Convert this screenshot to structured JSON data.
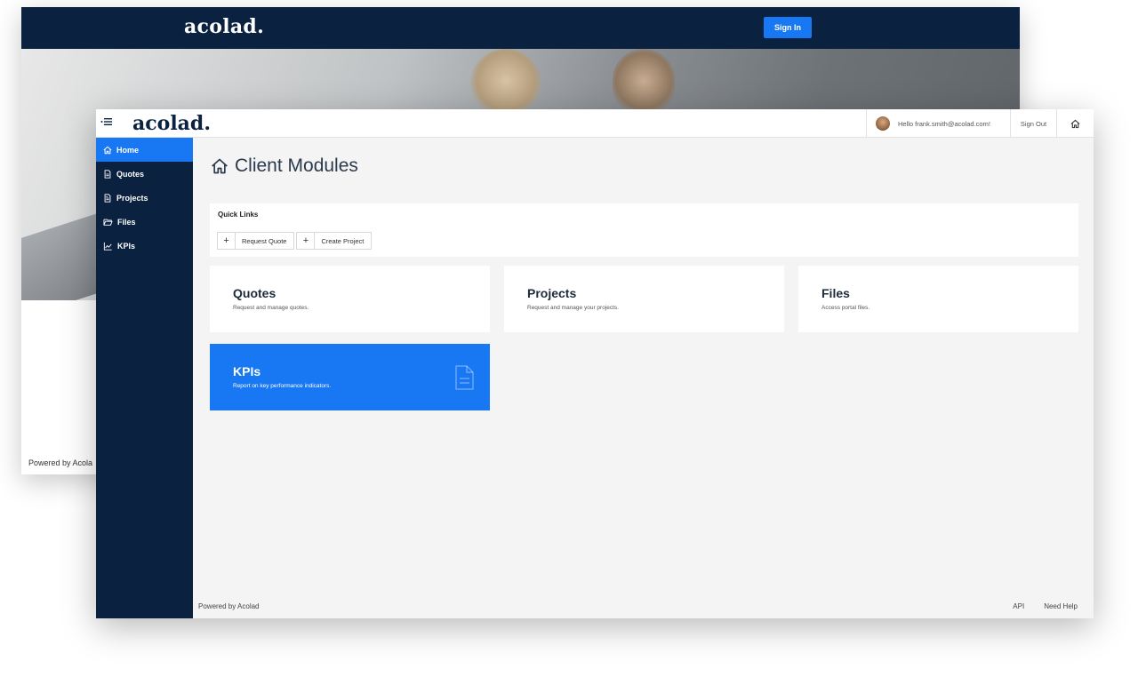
{
  "back_window": {
    "logo": "acolad.",
    "sign_in_label": "Sign In",
    "footer": "Powered by Acola"
  },
  "topbar": {
    "menu_icon": "menu-toggle-icon",
    "logo": "acolad.",
    "greeting": "Hello frank.smith@acolad.com!",
    "sign_out_label": "Sign Out",
    "home_icon": "home-icon"
  },
  "sidebar": {
    "items": [
      {
        "label": "Home",
        "icon": "home-icon",
        "active": true
      },
      {
        "label": "Quotes",
        "icon": "document-icon",
        "active": false
      },
      {
        "label": "Projects",
        "icon": "document-icon",
        "active": false
      },
      {
        "label": "Files",
        "icon": "folder-icon",
        "active": false
      },
      {
        "label": "KPIs",
        "icon": "chart-line-icon",
        "active": false
      }
    ]
  },
  "main": {
    "title": "Client Modules",
    "quick_links": {
      "title": "Quick Links",
      "buttons": [
        {
          "label": "Request Quote",
          "icon": "plus-icon"
        },
        {
          "label": "Create Project",
          "icon": "plus-icon"
        }
      ]
    },
    "cards": [
      {
        "title": "Quotes",
        "description": "Request and manage quotes."
      },
      {
        "title": "Projects",
        "description": "Request and manage your projects."
      },
      {
        "title": "Files",
        "description": "Access portal files."
      },
      {
        "title": "KPIs",
        "description": "Report on key performance indicators.",
        "icon": "document-icon"
      }
    ]
  },
  "footer": {
    "powered_by": "Powered by Acolad",
    "links": [
      "API",
      "Need Help"
    ]
  },
  "colors": {
    "navy": "#0b2140",
    "accent_blue": "#1877f2",
    "background": "#f4f4f4"
  }
}
